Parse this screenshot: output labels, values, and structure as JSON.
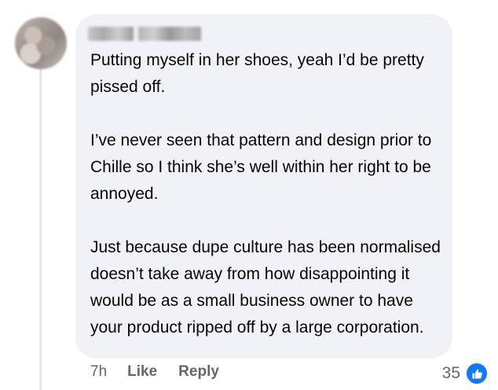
{
  "comment": {
    "author_name": "",
    "paragraphs": [
      "Putting myself in her shoes, yeah I’d be pretty pissed off.",
      "I’ve never seen that pattern and design prior to Chille so I think she’s well within her right to be annoyed.",
      "Just because dupe culture has been normalised doesn’t take away from how disappointing it would be as a small business owner to have your product ripped off by a large corporation."
    ],
    "timestamp": "7h",
    "like_label": "Like",
    "reply_label": "Reply",
    "reaction_count": "35",
    "reaction_icon": "thumbs-up-icon",
    "accent_color": "#1877f2"
  }
}
